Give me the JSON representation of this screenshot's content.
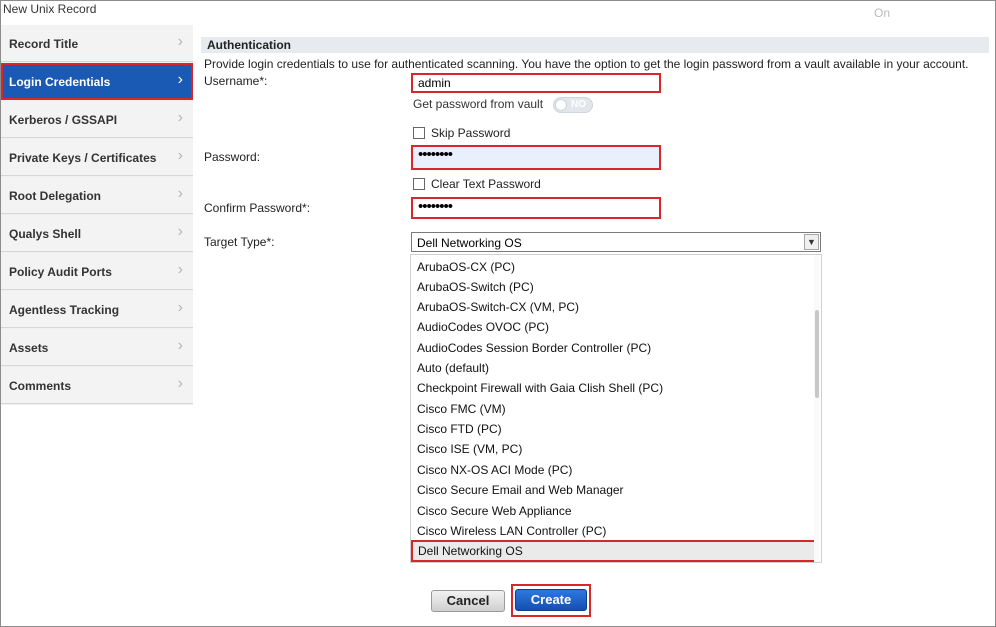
{
  "window": {
    "title": "New Unix Record",
    "status": "On"
  },
  "sidebar": {
    "items": [
      {
        "label": "Record Title",
        "active": false
      },
      {
        "label": "Login Credentials",
        "active": true
      },
      {
        "label": "Kerberos / GSSAPI",
        "active": false
      },
      {
        "label": "Private Keys / Certificates",
        "active": false
      },
      {
        "label": "Root Delegation",
        "active": false
      },
      {
        "label": "Qualys Shell",
        "active": false
      },
      {
        "label": "Policy Audit Ports",
        "active": false
      },
      {
        "label": "Agentless Tracking",
        "active": false
      },
      {
        "label": "Assets",
        "active": false
      },
      {
        "label": "Comments",
        "active": false
      }
    ],
    "chevron": "›"
  },
  "auth": {
    "header": "Authentication",
    "description": "Provide login credentials to use for authenticated scanning. You have the option to get the login password from a vault available in your account.",
    "username_label": "Username*:",
    "username_value": "admin",
    "vault_label": "Get password from vault",
    "vault_toggle": "NO",
    "skip_password": "Skip Password",
    "password_label": "Password:",
    "password_value": "••••••••",
    "clear_text": "Clear Text Password",
    "confirm_label": "Confirm Password*:",
    "confirm_value": "••••••••",
    "target_label": "Target Type*:",
    "target_selected": "Dell Networking OS",
    "target_options": [
      "ArubaOS-CX (PC)",
      "ArubaOS-Switch (PC)",
      "ArubaOS-Switch-CX (VM, PC)",
      "AudioCodes OVOC (PC)",
      "AudioCodes Session Border Controller (PC)",
      "Auto (default)",
      "Checkpoint Firewall with Gaia Clish Shell (PC)",
      "Cisco FMC (VM)",
      "Cisco FTD (PC)",
      "Cisco ISE (VM, PC)",
      "Cisco NX-OS ACI Mode (PC)",
      "Cisco Secure Email and Web Manager",
      "Cisco Secure Web Appliance",
      "Cisco Wireless LAN Controller (PC)",
      "Dell Networking OS"
    ]
  },
  "buttons": {
    "cancel": "Cancel",
    "create": "Create"
  },
  "colors": {
    "accent": "#1b5ab4",
    "highlight": "#d8262b"
  }
}
